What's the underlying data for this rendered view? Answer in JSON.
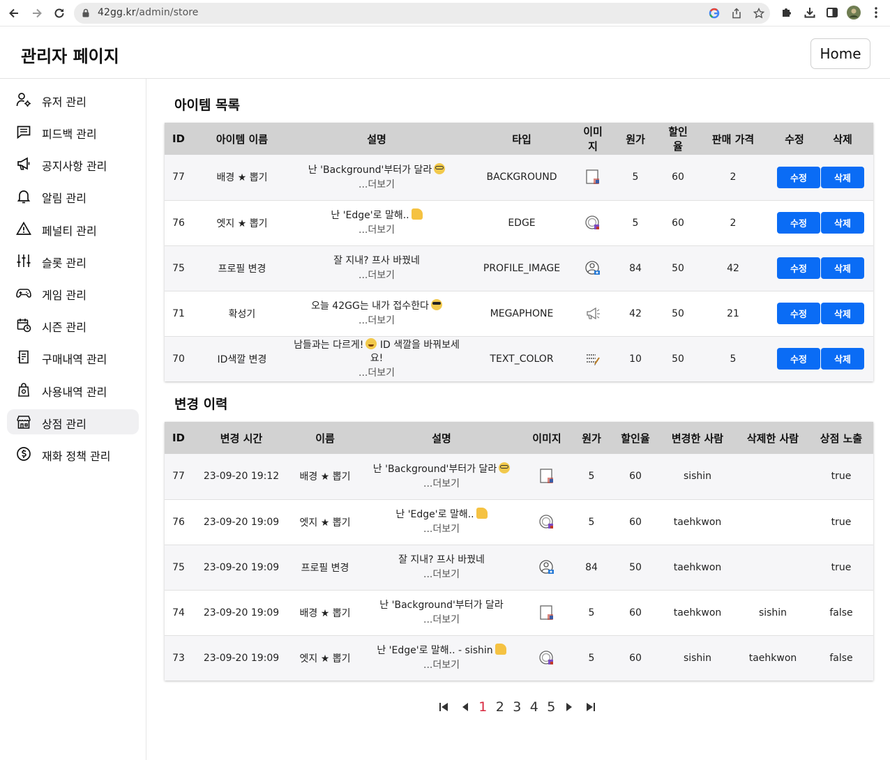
{
  "browser": {
    "url_host": "42gg.kr",
    "url_path": "/admin/store"
  },
  "header": {
    "title": "관리자 페이지",
    "home_label": "Home"
  },
  "sidebar": {
    "items": [
      {
        "label": "유저 관리",
        "icon": "user-gear-icon"
      },
      {
        "label": "피드백 관리",
        "icon": "chat-icon"
      },
      {
        "label": "공지사항 관리",
        "icon": "megaphone-icon"
      },
      {
        "label": "알림 관리",
        "icon": "bell-icon"
      },
      {
        "label": "페널티 관리",
        "icon": "warning-icon"
      },
      {
        "label": "슬롯 관리",
        "icon": "sliders-icon"
      },
      {
        "label": "게임 관리",
        "icon": "gamepad-icon"
      },
      {
        "label": "시즌 관리",
        "icon": "calendar-clock-icon"
      },
      {
        "label": "구매내역 관리",
        "icon": "receipt-icon"
      },
      {
        "label": "사용내역 관리",
        "icon": "bag-icon"
      },
      {
        "label": "상점 관리",
        "icon": "store-icon",
        "active": true
      },
      {
        "label": "재화 정책 관리",
        "icon": "dollar-icon"
      }
    ]
  },
  "items_section": {
    "title": "아이템 목록",
    "columns": [
      "ID",
      "아이템 이름",
      "설명",
      "타입",
      "이미지",
      "원가",
      "할인율",
      "판매 가격",
      "수정",
      "삭제"
    ],
    "edit_label": "수정",
    "delete_label": "삭제",
    "more_label": "...더보기",
    "rows": [
      {
        "id": "77",
        "name": "배경 ★ 뽑기",
        "desc": "난 'Background'부터가 달라",
        "emoji": "nerd",
        "type": "BACKGROUND",
        "image": "background-thumb-icon",
        "price": "5",
        "discount": "60",
        "sale": "2"
      },
      {
        "id": "76",
        "name": "엣지 ★ 뽑기",
        "desc": "난 'Edge'로 말해..",
        "emoji": "thumb",
        "type": "EDGE",
        "image": "edge-thumb-icon",
        "price": "5",
        "discount": "60",
        "sale": "2"
      },
      {
        "id": "75",
        "name": "프로필 변경",
        "desc": "잘 지내? 프사 바꿨네",
        "emoji": "",
        "type": "PROFILE_IMAGE",
        "image": "profile-thumb-icon",
        "price": "84",
        "discount": "50",
        "sale": "42"
      },
      {
        "id": "71",
        "name": "확성기",
        "desc": "오늘 42GG는 내가 접수한다",
        "emoji": "cool",
        "type": "MEGAPHONE",
        "image": "megaphone-thumb-icon",
        "price": "42",
        "discount": "50",
        "sale": "21"
      },
      {
        "id": "70",
        "name": "ID색깔 변경",
        "desc": "남들과는 다르게!",
        "desc_after": " ID 색깔을 바꿔보세요!",
        "emoji": "grin",
        "type": "TEXT_COLOR",
        "image": "textcolor-thumb-icon",
        "price": "10",
        "discount": "50",
        "sale": "5"
      }
    ]
  },
  "history_section": {
    "title": "변경 이력",
    "columns": [
      "ID",
      "변경 시간",
      "이름",
      "설명",
      "이미지",
      "원가",
      "할인율",
      "변경한 사람",
      "삭제한 사람",
      "상점 노출"
    ],
    "more_label": "...더보기",
    "rows": [
      {
        "id": "77",
        "time": "23-09-20 19:12",
        "name": "배경 ★ 뽑기",
        "desc": "난 'Background'부터가 달라",
        "emoji": "nerd",
        "image": "background-thumb-icon",
        "price": "5",
        "discount": "60",
        "changed_by": "sishin",
        "deleted_by": "",
        "visible": "true"
      },
      {
        "id": "76",
        "time": "23-09-20 19:09",
        "name": "엣지 ★ 뽑기",
        "desc": "난 'Edge'로 말해..",
        "emoji": "thumb",
        "image": "edge-thumb-icon",
        "price": "5",
        "discount": "60",
        "changed_by": "taehkwon",
        "deleted_by": "",
        "visible": "true"
      },
      {
        "id": "75",
        "time": "23-09-20 19:09",
        "name": "프로필 변경",
        "desc": "잘 지내? 프사 바꿨네",
        "emoji": "",
        "image": "profile-thumb-icon",
        "price": "84",
        "discount": "50",
        "changed_by": "taehkwon",
        "deleted_by": "",
        "visible": "true"
      },
      {
        "id": "74",
        "time": "23-09-20 19:09",
        "name": "배경 ★ 뽑기",
        "desc": "난 'Background'부터가 달라",
        "emoji": "",
        "image": "background-thumb-icon",
        "price": "5",
        "discount": "60",
        "changed_by": "taehkwon",
        "deleted_by": "sishin",
        "visible": "false"
      },
      {
        "id": "73",
        "time": "23-09-20 19:09",
        "name": "엣지 ★ 뽑기",
        "desc": "난 'Edge'로 말해.. - sishin",
        "emoji": "thumb",
        "image": "edge-thumb-icon",
        "price": "5",
        "discount": "60",
        "changed_by": "sishin",
        "deleted_by": "taehkwon",
        "visible": "false"
      }
    ]
  },
  "pagination": {
    "pages": [
      "1",
      "2",
      "3",
      "4",
      "5"
    ],
    "current": "1"
  },
  "colors": {
    "primary_button": "#0a6cf5",
    "current_page": "#d7263d",
    "table_header": "#d2d2d2",
    "active_sidebar": "#f0f0f2"
  }
}
